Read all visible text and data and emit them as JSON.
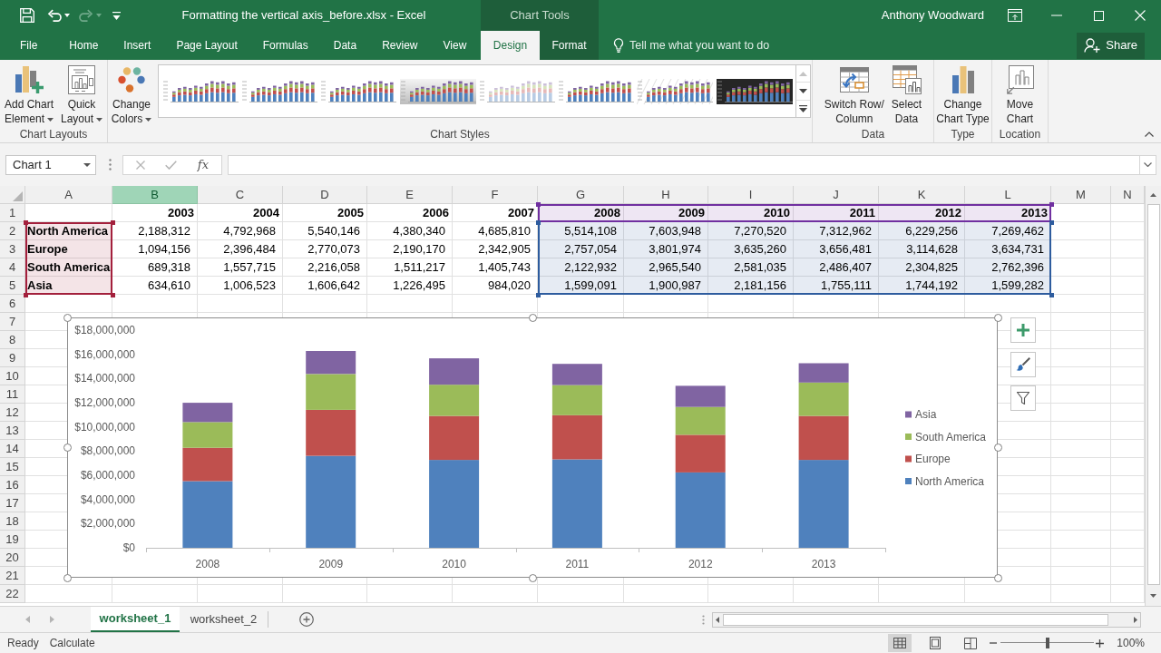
{
  "title_bar": {
    "title": "Formatting the vertical axis_before.xlsx - Excel",
    "context_label": "Chart Tools",
    "user": "Anthony Woodward",
    "redo_disabled": true
  },
  "ribbon_tabs": [
    {
      "label": "File",
      "selected": false,
      "contextual": false
    },
    {
      "label": "Home",
      "selected": false,
      "contextual": false
    },
    {
      "label": "Insert",
      "selected": false,
      "contextual": false
    },
    {
      "label": "Page Layout",
      "selected": false,
      "contextual": false
    },
    {
      "label": "Formulas",
      "selected": false,
      "contextual": false
    },
    {
      "label": "Data",
      "selected": false,
      "contextual": false
    },
    {
      "label": "Review",
      "selected": false,
      "contextual": false
    },
    {
      "label": "View",
      "selected": false,
      "contextual": false
    },
    {
      "label": "Design",
      "selected": true,
      "contextual": true
    },
    {
      "label": "Format",
      "selected": false,
      "contextual": true
    }
  ],
  "tell_me": {
    "placeholder": "Tell me what you want to do"
  },
  "share_button": {
    "label": "Share"
  },
  "ribbon_groups": [
    {
      "label": "Chart Layouts",
      "commands": [
        {
          "kind": "add_chart_element",
          "lines": [
            "Add Chart",
            "Element"
          ],
          "dropdown": true
        },
        {
          "kind": "quick_layout",
          "lines": [
            "Quick",
            "Layout"
          ],
          "dropdown": true
        }
      ]
    },
    {
      "label": "Chart Styles",
      "commands": [
        {
          "kind": "change_colors",
          "lines": [
            "Change",
            "Colors"
          ],
          "dropdown": true
        },
        {
          "kind": "gallery",
          "up_disabled": true,
          "styles": [
            {
              "kind": "plain"
            },
            {
              "kind": "plain"
            },
            {
              "kind": "plain"
            },
            {
              "kind": "gray"
            },
            {
              "kind": "faded"
            },
            {
              "kind": "plain"
            },
            {
              "kind": "hatched"
            },
            {
              "kind": "dark"
            }
          ]
        }
      ]
    },
    {
      "label": "Data",
      "commands": [
        {
          "kind": "switch_row_column",
          "lines": [
            "Switch Row/",
            "Column"
          ],
          "dropdown": false
        },
        {
          "kind": "select_data",
          "lines": [
            "Select",
            "Data"
          ],
          "dropdown": false
        }
      ]
    },
    {
      "label": "Type",
      "commands": [
        {
          "kind": "change_chart_type",
          "lines": [
            "Change",
            "Chart Type"
          ],
          "dropdown": false
        }
      ]
    },
    {
      "label": "Location",
      "commands": [
        {
          "kind": "move_chart",
          "lines": [
            "Move",
            "Chart"
          ],
          "dropdown": false
        }
      ]
    }
  ],
  "formula_bar": {
    "name_box": "Chart 1",
    "edit_buttons_disabled": true,
    "insert_function": "fx"
  },
  "sheet": {
    "columns": [
      {
        "label": "A",
        "selected": false
      },
      {
        "label": "B",
        "selected": true
      },
      {
        "label": "C",
        "selected": false
      },
      {
        "label": "D",
        "selected": false
      },
      {
        "label": "E",
        "selected": false
      },
      {
        "label": "F",
        "selected": false
      },
      {
        "label": "G",
        "selected": false
      },
      {
        "label": "H",
        "selected": false
      },
      {
        "label": "I",
        "selected": false
      },
      {
        "label": "J",
        "selected": false
      },
      {
        "label": "K",
        "selected": false
      },
      {
        "label": "L",
        "selected": false
      },
      {
        "label": "M",
        "selected": false
      },
      {
        "label": "N",
        "selected": false
      }
    ],
    "row_numbers": [
      "1",
      "2",
      "3",
      "4",
      "5",
      "6",
      "7",
      "8",
      "9",
      "10",
      "11",
      "12",
      "13",
      "14",
      "15",
      "16",
      "17",
      "18",
      "19",
      "20",
      "21",
      "22"
    ],
    "years": [
      "2003",
      "2004",
      "2005",
      "2006",
      "2007",
      "2008",
      "2009",
      "2010",
      "2011",
      "2012",
      "2013"
    ],
    "data_rows": [
      {
        "region": "North America",
        "values": [
          "2,188,312",
          "4,792,968",
          "5,540,146",
          "4,380,340",
          "4,685,810",
          "5,514,108",
          "7,603,948",
          "7,270,520",
          "7,312,962",
          "6,229,256",
          "7,269,462"
        ]
      },
      {
        "region": "Europe",
        "values": [
          "1,094,156",
          "2,396,484",
          "2,770,073",
          "2,190,170",
          "2,342,905",
          "2,757,054",
          "3,801,974",
          "3,635,260",
          "3,656,481",
          "3,114,628",
          "3,634,731"
        ]
      },
      {
        "region": "South America",
        "values": [
          "689,318",
          "1,557,715",
          "2,216,058",
          "1,511,217",
          "1,405,743",
          "2,122,932",
          "2,965,540",
          "2,581,035",
          "2,486,407",
          "2,304,825",
          "2,762,396"
        ]
      },
      {
        "region": "Asia",
        "values": [
          "634,610",
          "1,006,523",
          "1,606,642",
          "1,226,495",
          "984,020",
          "1,599,091",
          "1,900,987",
          "2,181,156",
          "1,755,111",
          "1,744,192",
          "1,599,282"
        ]
      }
    ],
    "highlight_ranges": [
      {
        "kind": "series_names",
        "color": "#a3203c"
      },
      {
        "kind": "categories",
        "color": "#7030a0"
      },
      {
        "kind": "values",
        "color": "#2e5c9e"
      }
    ]
  },
  "chart": {
    "selected": true,
    "chart_data": {
      "type": "bar",
      "orientation": "vertical",
      "stacked": true,
      "legend": "right",
      "categories": [
        "2008",
        "2009",
        "2010",
        "2011",
        "2012",
        "2013"
      ],
      "series": [
        {
          "name": "North America",
          "color": "#4f81bd",
          "values": [
            5514108,
            7603948,
            7270520,
            7312962,
            6229256,
            7269462
          ]
        },
        {
          "name": "Europe",
          "color": "#c0504d",
          "values": [
            2757054,
            3801974,
            3635260,
            3656481,
            3114628,
            3634731
          ]
        },
        {
          "name": "South America",
          "color": "#9bbb59",
          "values": [
            2122932,
            2965540,
            2581035,
            2486407,
            2304825,
            2762396
          ]
        },
        {
          "name": "Asia",
          "color": "#8064a2",
          "values": [
            1599091,
            1900987,
            2181156,
            1755111,
            1744192,
            1599282
          ]
        }
      ],
      "ylim": [
        0,
        18000000
      ],
      "yticks": [
        {
          "value": 0,
          "label": "$0"
        },
        {
          "value": 2000000,
          "label": "$2,000,000"
        },
        {
          "value": 4000000,
          "label": "$4,000,000"
        },
        {
          "value": 6000000,
          "label": "$6,000,000"
        },
        {
          "value": 8000000,
          "label": "$8,000,000"
        },
        {
          "value": 10000000,
          "label": "$10,000,000"
        },
        {
          "value": 12000000,
          "label": "$12,000,000"
        },
        {
          "value": 14000000,
          "label": "$14,000,000"
        },
        {
          "value": 16000000,
          "label": "$16,000,000"
        },
        {
          "value": 18000000,
          "label": "$18,000,000"
        }
      ]
    }
  },
  "sheet_tabs": [
    {
      "label": "worksheet_1",
      "selected": true
    },
    {
      "label": "worksheet_2",
      "selected": false
    }
  ],
  "status_bar": {
    "mode": "Ready",
    "calculate": "Calculate",
    "views": [
      {
        "kind": "normal",
        "selected": true
      },
      {
        "kind": "page_layout",
        "selected": false
      },
      {
        "kind": "page_break_preview",
        "selected": false
      }
    ],
    "zoom": {
      "level": 0.5,
      "reading": "100%"
    }
  }
}
